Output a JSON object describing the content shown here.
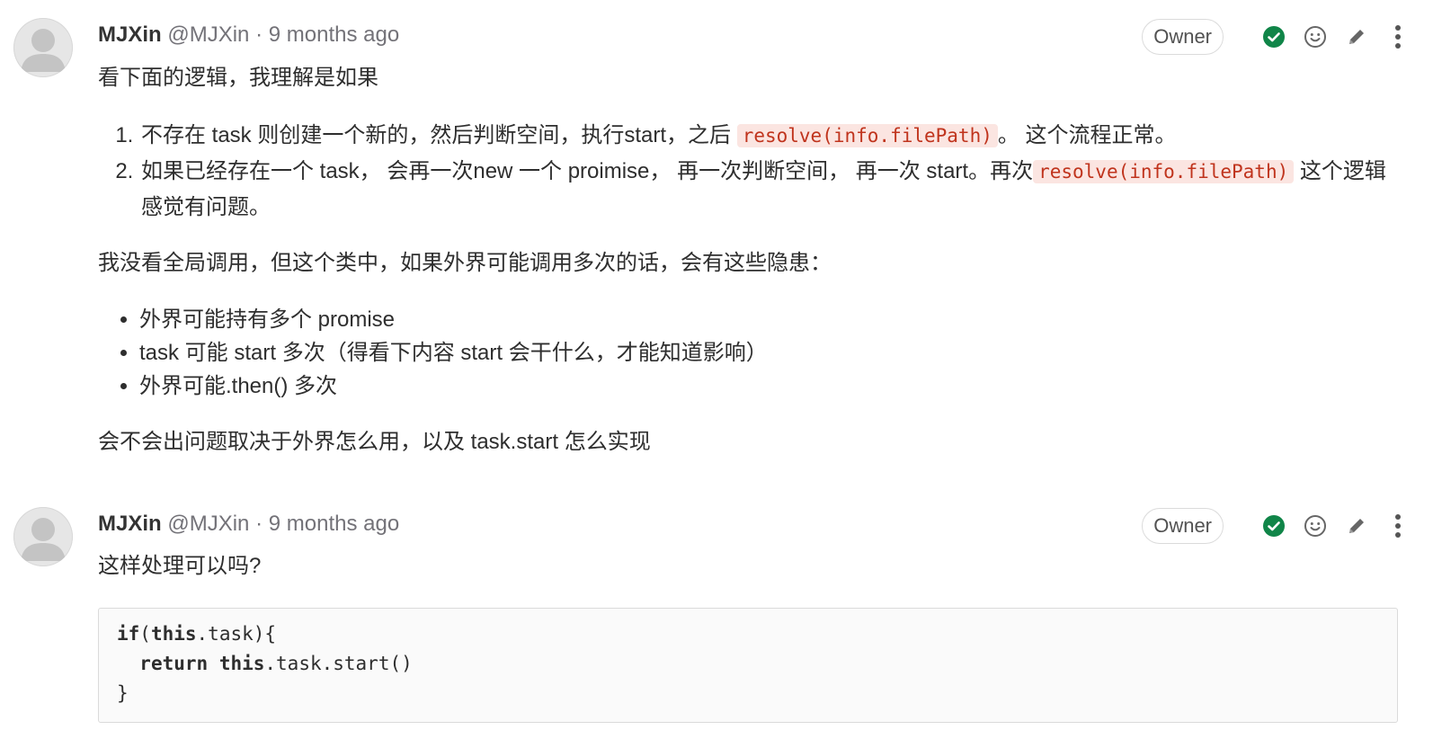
{
  "notes": [
    {
      "author_name": "MJXin",
      "author_handle": "@MJXin",
      "separator": "·",
      "time": "9 months ago",
      "role_badge": "Owner",
      "icons": [
        "check-circle-icon",
        "smiley-icon",
        "pencil-icon",
        "more-vertical-icon"
      ],
      "intro": "看下面的逻辑，我理解是如果",
      "step1_pre": "不存在 task 则创建一个新的，然后判断空间，执行start，之后",
      "step1_code": "resolve(info.filePath)",
      "step1_post": "。 这个流程正常。",
      "step2_pre": "如果已经存在一个 task， 会再一次new 一个 proimise， 再一次判断空间， 再一次 start。再次",
      "step2_code": "resolve(info.filePath)",
      "step2_post": "这个逻辑感觉有问题。",
      "risk_intro": "我没看全局调用，但这个类中，如果外界可能调用多次的话，会有这些隐患：",
      "risks": [
        "外界可能持有多个 promise",
        "task 可能 start 多次（得看下内容 start 会干什么，才能知道影响）",
        "外界可能.then() 多次"
      ],
      "conclusion": "会不会出问题取决于外界怎么用，以及 task.start 怎么实现"
    },
    {
      "author_name": "MJXin",
      "author_handle": "@MJXin",
      "separator": "·",
      "time": "9 months ago",
      "role_badge": "Owner",
      "question": "这样处理可以吗?",
      "code_lines": [
        {
          "kw1": "if",
          "p1": "(",
          "kw2": "this",
          "p2": ".task){"
        },
        {
          "indent": "  ",
          "kw1": "return",
          "sp": " ",
          "kw2": "this",
          "p2": ".task.start()"
        },
        {
          "p1": "}"
        }
      ]
    }
  ],
  "colors": {
    "check": "#108548",
    "inline_code_text": "#c0341d",
    "inline_code_bg": "#fbe5e1",
    "muted": "#737278"
  }
}
